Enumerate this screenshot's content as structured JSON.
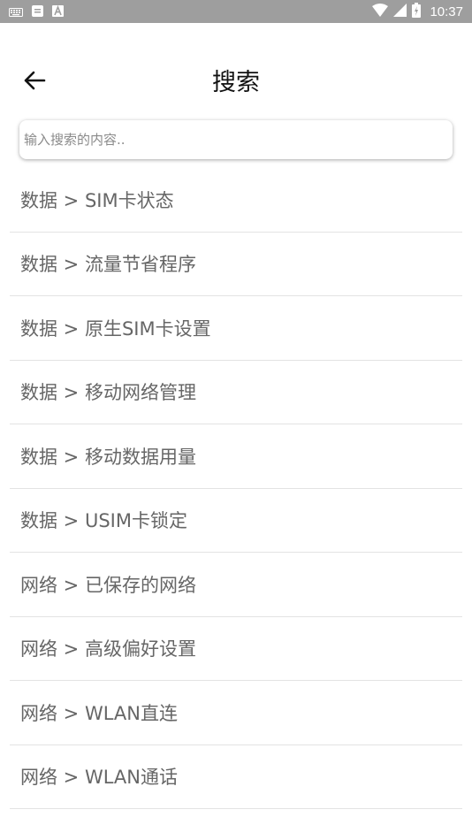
{
  "status_bar": {
    "time": "10:37",
    "icons": [
      "keyboard-icon",
      "sim-notification-icon",
      "app-a-icon",
      "wifi-icon",
      "cell-signal-icon",
      "battery-icon"
    ]
  },
  "header": {
    "back_icon": "arrow-left-icon",
    "title": "搜索"
  },
  "search": {
    "placeholder": "输入搜索的内容..",
    "value": ""
  },
  "results": [
    "数据 > SIM卡状态",
    "数据 > 流量节省程序",
    "数据 > 原生SIM卡设置",
    "数据 > 移动网络管理",
    "数据 > 移动数据用量",
    "数据 > USIM卡锁定",
    "网络 > 已保存的网络",
    "网络 > 高级偏好设置",
    "网络 > WLAN直连",
    "网络 > WLAN通话"
  ],
  "colors": {
    "status_bar_bg": "#9e9e9e",
    "title_text": "#111111",
    "item_text": "#666666",
    "divider": "#e3e3e3"
  }
}
